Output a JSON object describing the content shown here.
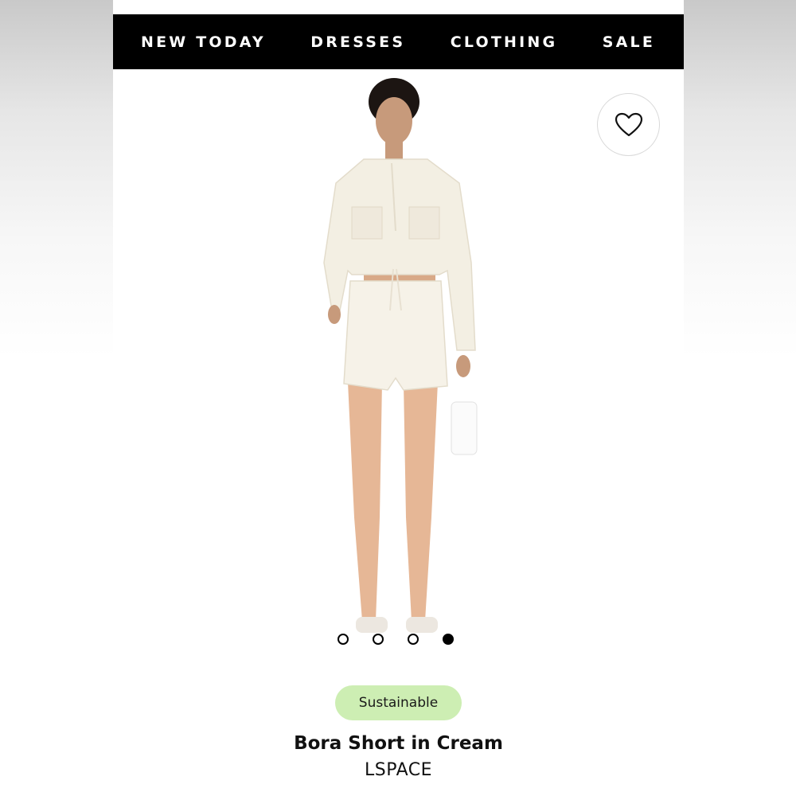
{
  "nav": {
    "items": [
      {
        "label": "NEW TODAY"
      },
      {
        "label": "DRESSES"
      },
      {
        "label": "CLOTHING"
      },
      {
        "label": "SALE"
      }
    ]
  },
  "icons": {
    "favorite": "heart-icon"
  },
  "carousel": {
    "slide_count": 4,
    "active_index": 3
  },
  "product": {
    "badge": "Sustainable",
    "name": "Bora Short in Cream",
    "brand": "LSPACE"
  },
  "colors": {
    "nav_background": "#000000",
    "nav_text": "#ffffff",
    "badge_background": "#cdeeb3",
    "garment": "#f3efe3"
  }
}
